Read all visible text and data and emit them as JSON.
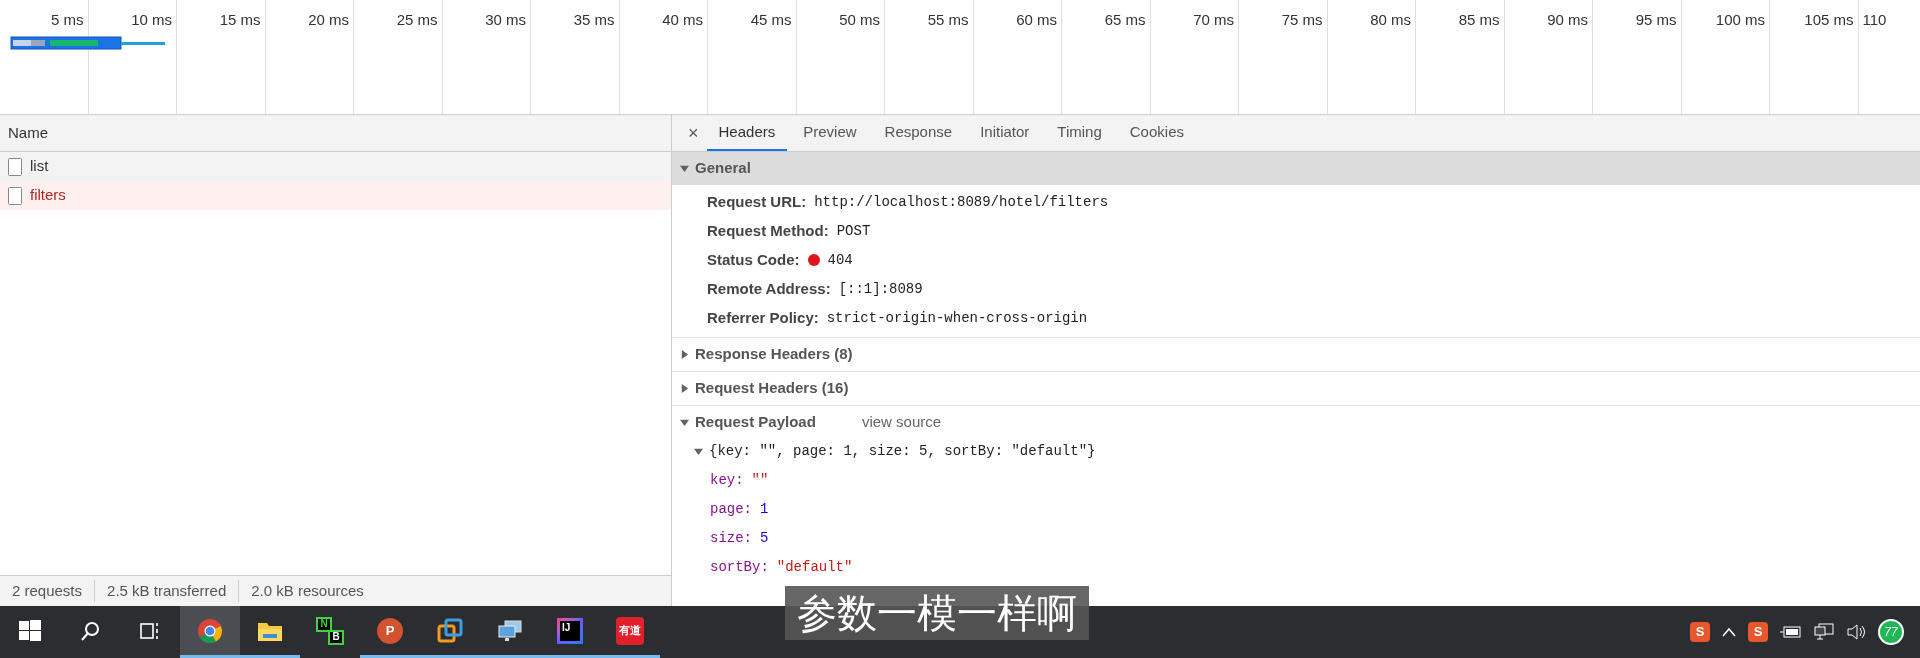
{
  "timeline": {
    "ticks": [
      "5 ms",
      "10 ms",
      "15 ms",
      "20 ms",
      "25 ms",
      "30 ms",
      "35 ms",
      "40 ms",
      "45 ms",
      "50 ms",
      "55 ms",
      "60 ms",
      "65 ms",
      "70 ms",
      "75 ms",
      "80 ms",
      "85 ms",
      "90 ms",
      "95 ms",
      "100 ms",
      "105 ms",
      "110"
    ]
  },
  "requests": {
    "column": "Name",
    "rows": [
      {
        "name": "list",
        "failed": false
      },
      {
        "name": "filters",
        "failed": true
      }
    ]
  },
  "details": {
    "close": "×",
    "tabs": [
      {
        "label": "Headers",
        "selected": true
      },
      {
        "label": "Preview",
        "selected": false
      },
      {
        "label": "Response",
        "selected": false
      },
      {
        "label": "Initiator",
        "selected": false
      },
      {
        "label": "Timing",
        "selected": false
      },
      {
        "label": "Cookies",
        "selected": false
      }
    ],
    "general": {
      "title": "General",
      "expanded": true,
      "rows": [
        {
          "label": "Request URL:",
          "value": "http://localhost:8089/hotel/filters"
        },
        {
          "label": "Request Method:",
          "value": "POST"
        },
        {
          "label": "Status Code:",
          "value": "404",
          "color": "#e0141e"
        },
        {
          "label": "Remote Address:",
          "value": "[::1]:8089"
        },
        {
          "label": "Referrer Policy:",
          "value": "strict-origin-when-cross-origin"
        }
      ]
    },
    "sections": [
      {
        "title": "Response Headers (8)",
        "expanded": false
      },
      {
        "title": "Request Headers (16)",
        "expanded": false
      }
    ],
    "payload": {
      "title": "Request Payload",
      "expanded": true,
      "link": "view source",
      "summary": "{key: \"\", page: 1, size: 5, sortBy: \"default\"}",
      "summary_expanded": true,
      "fields": [
        {
          "key": "key:",
          "value": "\"\"",
          "kind": "string"
        },
        {
          "key": "page:",
          "value": "1",
          "kind": "number"
        },
        {
          "key": "size:",
          "value": "5",
          "kind": "number"
        },
        {
          "key": "sortBy:",
          "value": "\"default\"",
          "kind": "string"
        }
      ]
    }
  },
  "status_bar": [
    "2 requests",
    "2.5 kB transferred",
    "2.0 kB resources"
  ],
  "subtitle": "参数一模一样啊",
  "taskbar": {
    "apps": [
      {
        "kind": "windows",
        "selected": false,
        "running": false
      },
      {
        "kind": "search",
        "selected": false,
        "running": false
      },
      {
        "kind": "taskview",
        "selected": false,
        "running": false
      },
      {
        "kind": "chrome",
        "selected": true,
        "running": true
      },
      {
        "kind": "folder",
        "selected": false,
        "running": true
      },
      {
        "kind": "nb",
        "label": "N",
        "label2": "B",
        "selected": false,
        "running": false
      },
      {
        "kind": "powerpoint",
        "label": "P",
        "selected": false,
        "running": true
      },
      {
        "kind": "vmware",
        "selected": false,
        "running": true
      },
      {
        "kind": "remote",
        "selected": false,
        "running": true
      },
      {
        "kind": "intellij",
        "label": "IJ",
        "selected": false,
        "running": true
      },
      {
        "kind": "youdao",
        "label": "有道",
        "selected": false,
        "running": true
      }
    ],
    "tray": [
      {
        "kind": "sogou",
        "label": "S"
      },
      {
        "kind": "chevron"
      },
      {
        "kind": "sogou",
        "label": "S"
      },
      {
        "kind": "battery"
      },
      {
        "kind": "network"
      },
      {
        "kind": "volume"
      },
      {
        "kind": "badge",
        "label": "77"
      }
    ]
  }
}
